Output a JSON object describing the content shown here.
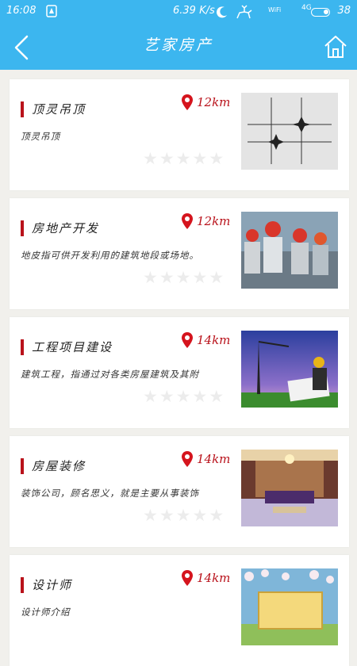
{
  "status": {
    "time": "16:08",
    "speed": "6.39 K/s",
    "wifi_label": "WiFi",
    "net_label": "4G",
    "battery": "38"
  },
  "header": {
    "title": "艺家房产",
    "back_icon": "chevron-left-icon",
    "home_icon": "home-icon"
  },
  "listings": [
    {
      "title": "顶灵吊顶",
      "desc": "顶灵吊顶",
      "distance": "12km",
      "rating": 0,
      "image": "ceiling-image"
    },
    {
      "title": "房地产开发",
      "desc": "地皮指可供开发利用的建筑地段或场地。",
      "distance": "12km",
      "rating": 0,
      "image": "workers-image"
    },
    {
      "title": "工程项目建设",
      "desc": "建筑工程，指通过对各类房屋建筑及其附",
      "distance": "14km",
      "rating": 0,
      "image": "construction-image"
    },
    {
      "title": "房屋装修",
      "desc": "装饰公司，顾名思义，就是主要从事装饰",
      "distance": "14km",
      "rating": 0,
      "image": "living-room-image"
    },
    {
      "title": "设计师",
      "desc": "设计师介绍",
      "distance": "14km",
      "rating": 0,
      "image": "designer-image"
    }
  ],
  "colors": {
    "accent": "#3cb6ef",
    "brand_red": "#b9121b",
    "background": "#f1f0ec"
  }
}
